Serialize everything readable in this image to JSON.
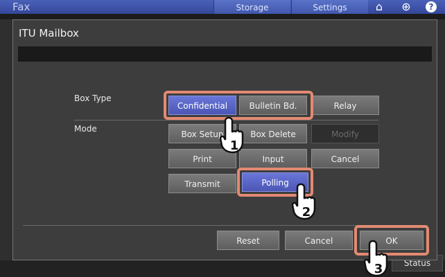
{
  "app": {
    "title": "Fax",
    "tabs": [
      "Storage",
      "Settings"
    ],
    "status_label": "Status"
  },
  "dialog": {
    "title": "ITU Mailbox",
    "box_type_label": "Box Type",
    "mode_label": "Mode",
    "box_type_buttons": [
      {
        "label": "Confidential",
        "state": "selected"
      },
      {
        "label": "Bulletin Bd.",
        "state": "normal"
      },
      {
        "label": "Relay",
        "state": "normal"
      }
    ],
    "mode_buttons": [
      {
        "label": "Box Setup",
        "state": "normal"
      },
      {
        "label": "Box Delete",
        "state": "normal"
      },
      {
        "label": "Modify",
        "state": "disabled"
      },
      {
        "label": "Print",
        "state": "normal"
      },
      {
        "label": "Input",
        "state": "normal"
      },
      {
        "label": "Cancel",
        "state": "normal"
      },
      {
        "label": "Transmit",
        "state": "normal"
      },
      {
        "label": "Polling",
        "state": "selected"
      }
    ],
    "footer_buttons": {
      "reset": "Reset",
      "cancel": "Cancel",
      "ok": "OK"
    }
  },
  "callouts": [
    "1",
    "2",
    "3"
  ],
  "colors": {
    "accent": "#5b66c8",
    "highlight": "#e38a72",
    "header": "#3c50a8"
  }
}
